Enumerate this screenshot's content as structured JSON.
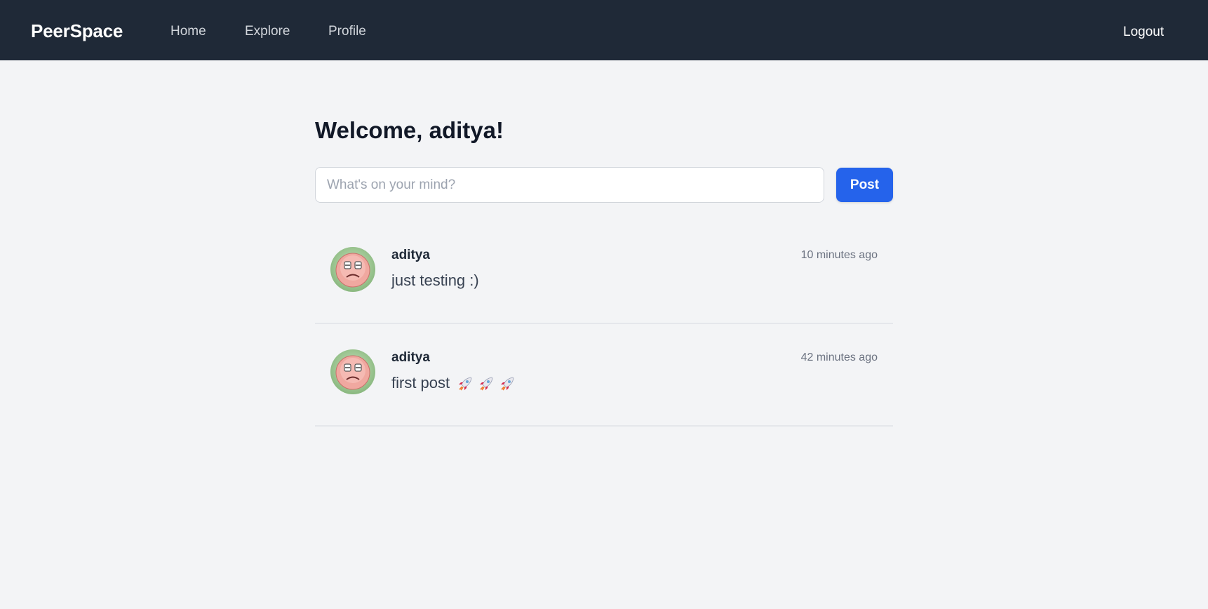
{
  "nav": {
    "brand": "PeerSpace",
    "links": [
      {
        "label": "Home"
      },
      {
        "label": "Explore"
      },
      {
        "label": "Profile"
      }
    ],
    "logout_label": "Logout"
  },
  "welcome": {
    "text": "Welcome, aditya!"
  },
  "composer": {
    "placeholder": "What's on your mind?",
    "value": "",
    "post_label": "Post"
  },
  "posts": [
    {
      "author": "aditya",
      "time": "10 minutes ago",
      "content": "just testing :)",
      "avatar_icon": "sad-face-icon"
    },
    {
      "author": "aditya",
      "time": "42 minutes ago",
      "content": "first post",
      "content_icons": [
        "rocket-icon",
        "rocket-icon",
        "rocket-icon"
      ],
      "avatar_icon": "sad-face-icon"
    }
  ],
  "colors": {
    "navbar_bg": "#1f2937",
    "page_bg": "#f3f4f6",
    "accent": "#2563eb"
  }
}
